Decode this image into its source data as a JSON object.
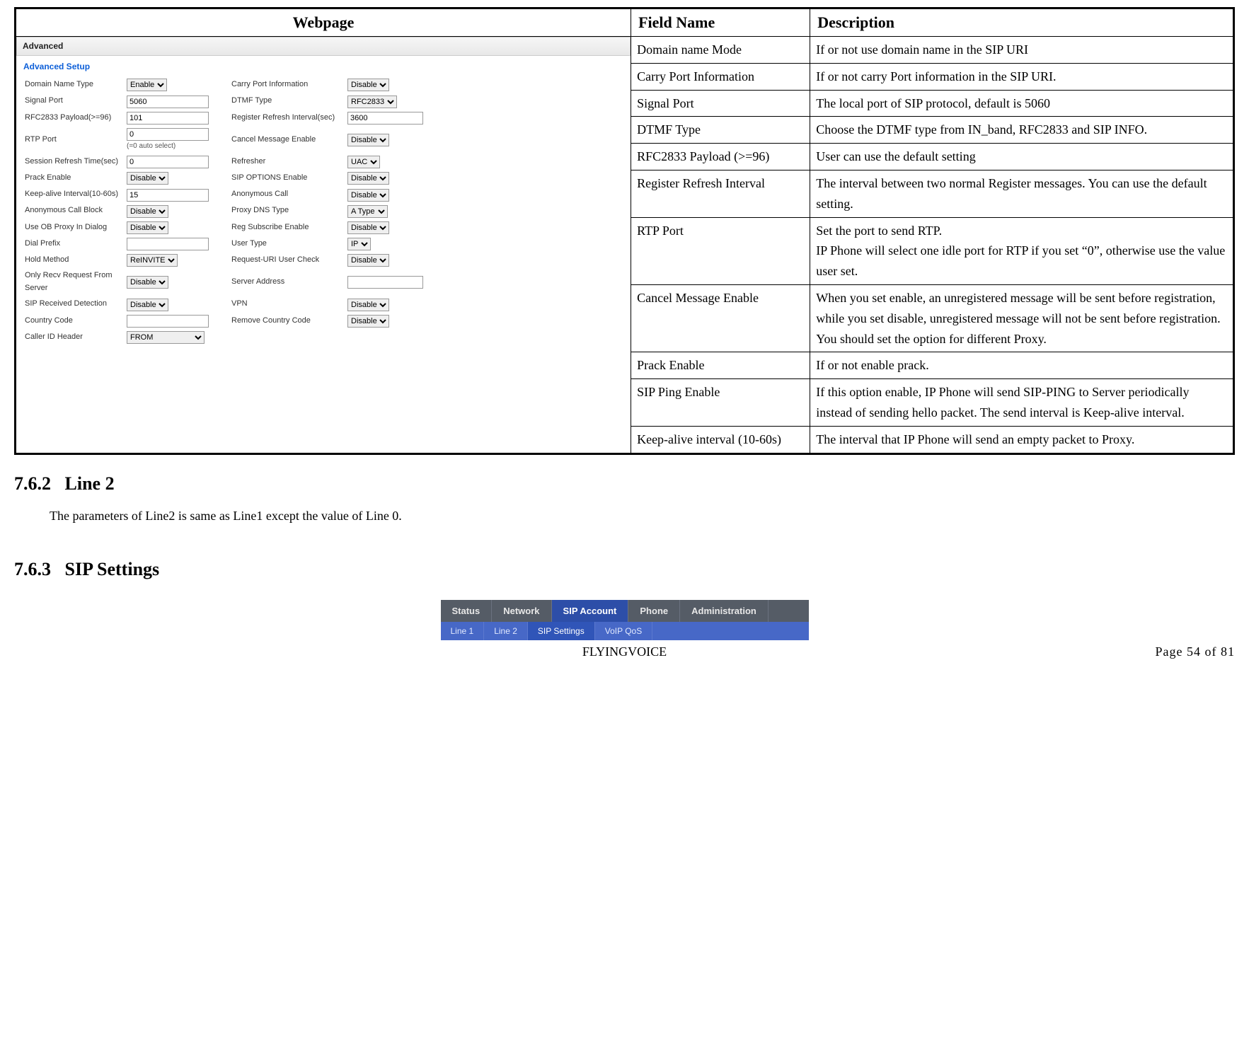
{
  "header": {
    "webpage": "Webpage",
    "fieldname": "Field Name",
    "description": "Description"
  },
  "webpage": {
    "barTitle": "Advanced",
    "setupTitle": "Advanced Setup",
    "leftFields": [
      {
        "label": "Domain Name Type",
        "type": "select",
        "value": "Enable"
      },
      {
        "label": "Signal Port",
        "type": "input",
        "value": "5060"
      },
      {
        "label": "RFC2833 Payload(>=96)",
        "type": "input",
        "value": "101"
      },
      {
        "label": "RTP Port",
        "type": "input",
        "value": "0",
        "note": "(=0 auto select)"
      },
      {
        "label": "Session Refresh Time(sec)",
        "type": "input",
        "value": "0"
      },
      {
        "label": "Prack Enable",
        "type": "select",
        "value": "Disable"
      },
      {
        "label": "Keep-alive Interval(10-60s)",
        "type": "input",
        "value": "15"
      },
      {
        "label": "Anonymous Call Block",
        "type": "select",
        "value": "Disable"
      },
      {
        "label": "Use OB Proxy In Dialog",
        "type": "select",
        "value": "Disable"
      },
      {
        "label": "Dial Prefix",
        "type": "input",
        "value": ""
      },
      {
        "label": "Hold Method",
        "type": "select",
        "value": "ReINVITE"
      },
      {
        "label": "Only Recv Request From Server",
        "type": "select",
        "value": "Disable"
      },
      {
        "label": "SIP Received Detection",
        "type": "select",
        "value": "Disable"
      },
      {
        "label": "Country Code",
        "type": "input",
        "value": ""
      },
      {
        "label": "Caller ID Header",
        "type": "select-big",
        "value": "FROM"
      }
    ],
    "rightFields": [
      {
        "label": "Carry Port Information",
        "type": "select",
        "value": "Disable"
      },
      {
        "label": "DTMF Type",
        "type": "select",
        "value": "RFC2833"
      },
      {
        "label": "Register Refresh Interval(sec)",
        "type": "input",
        "value": "3600"
      },
      {
        "label": "Cancel Message Enable",
        "type": "select",
        "value": "Disable"
      },
      {
        "label": "Refresher",
        "type": "select",
        "value": "UAC"
      },
      {
        "label": "SIP OPTIONS Enable",
        "type": "select",
        "value": "Disable"
      },
      {
        "label": "Anonymous Call",
        "type": "select",
        "value": "Disable"
      },
      {
        "label": "Proxy DNS Type",
        "type": "select",
        "value": "A Type"
      },
      {
        "label": "Reg Subscribe Enable",
        "type": "select",
        "value": "Disable"
      },
      {
        "label": "User Type",
        "type": "select",
        "value": "IP"
      },
      {
        "label": "Request-URI User Check",
        "type": "select",
        "value": "Disable"
      },
      {
        "label": "Server Address",
        "type": "input",
        "value": ""
      },
      {
        "label": "VPN",
        "type": "select",
        "value": "Disable"
      },
      {
        "label": "Remove Country Code",
        "type": "select",
        "value": "Disable"
      }
    ]
  },
  "rows": [
    {
      "field": "Domain name Mode",
      "desc": "If or not use domain name in the SIP URI"
    },
    {
      "field": "Carry Port Information",
      "desc": "If or not carry Port information in the SIP URI."
    },
    {
      "field": "Signal Port",
      "desc": "The local port of SIP protocol, default is 5060"
    },
    {
      "field": "DTMF Type",
      "desc": "Choose the DTMF type from IN_band, RFC2833 and SIP INFO."
    },
    {
      "field": "RFC2833 Payload (>=96)",
      "desc": "User can use the default setting"
    },
    {
      "field": "Register Refresh Interval",
      "desc": "The interval between two normal Register messages. You can use the default setting."
    },
    {
      "field": "RTP Port",
      "desc": "Set the port to send RTP.\nIP Phone will select one idle port for RTP if you set “0”, otherwise use the value user set."
    },
    {
      "field": "Cancel Message Enable",
      "desc": "When you set enable, an unregistered message will be sent before registration, while you set disable, unregistered message will not be sent before registration. You should set the option for different Proxy."
    },
    {
      "field": "Prack Enable",
      "desc": "If or not enable prack."
    },
    {
      "field": "SIP Ping Enable",
      "desc": "If this option enable, IP Phone will send SIP-PING to Server periodically instead of sending hello packet. The send interval is Keep-alive interval."
    },
    {
      "field": "Keep-alive interval (10-60s)",
      "desc": "The interval that IP Phone will send an empty packet to Proxy."
    }
  ],
  "sections": {
    "line2": {
      "num": "7.6.2",
      "title": "Line 2",
      "body": "The parameters of Line2 is same as Line1 except the value of Line 0."
    },
    "sip": {
      "num": "7.6.3",
      "title": "SIP Settings"
    }
  },
  "nav": {
    "main": [
      "Status",
      "Network",
      "SIP Account",
      "Phone",
      "Administration"
    ],
    "mainActive": "SIP Account",
    "sub": [
      "Line 1",
      "Line 2",
      "SIP Settings",
      "VoIP QoS"
    ],
    "subActive": "SIP Settings"
  },
  "footer": {
    "brand": "FLYINGVOICE",
    "page": "Page 54 of 81"
  }
}
